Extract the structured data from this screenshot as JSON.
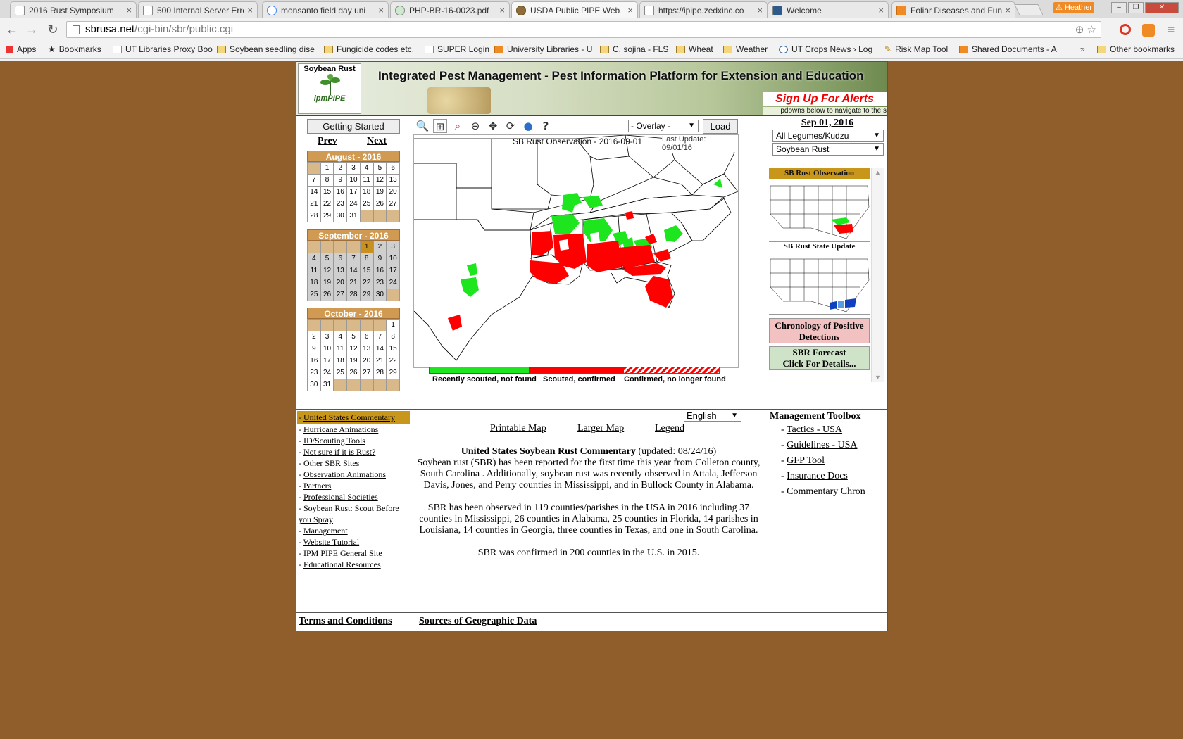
{
  "browser": {
    "tabs": [
      {
        "label": "2016 Rust Symposium"
      },
      {
        "label": "500 Internal Server Erro"
      },
      {
        "label": "monsanto field day uni"
      },
      {
        "label": "PHP-BR-16-0023.pdf"
      },
      {
        "label": "USDA Public PIPE Web"
      },
      {
        "label": "https://ipipe.zedxinc.co"
      },
      {
        "label": "Welcome"
      },
      {
        "label": "Foliar Diseases and Fun"
      }
    ],
    "user": "Heather",
    "url_domain": "sbrusa.net",
    "url_path": "/cgi-bin/sbr/public.cgi",
    "bookmarks": [
      "Apps",
      "Bookmarks",
      "UT Libraries Proxy Boo",
      "Soybean seedling dise",
      "Fungicide codes etc.",
      "SUPER Login",
      "University Libraries - U",
      "C. sojina - FLS",
      "Wheat",
      "Weather",
      "UT Crops News › Log",
      "Risk Map Tool",
      "Shared Documents - A",
      "»",
      "Other bookmarks"
    ]
  },
  "banner": {
    "logo_text": "Soybean Rust",
    "logo_sub": "ipmPIPE",
    "title": "Integrated Pest Management - Pest Information Platform for Extension and Education",
    "signup": "Sign Up For Alerts",
    "ticker": "pdowns below to navigate to the s"
  },
  "left": {
    "getting_started": "Getting Started",
    "prev": "Prev",
    "next": "Next",
    "months": [
      {
        "title": "August - 2016",
        "cells": [
          "",
          "1",
          "2",
          "3",
          "4",
          "5",
          "6",
          "7",
          "8",
          "9",
          "10",
          "11",
          "12",
          "13",
          "14",
          "15",
          "16",
          "17",
          "18",
          "19",
          "20",
          "21",
          "22",
          "23",
          "24",
          "25",
          "26",
          "27",
          "28",
          "29",
          "30",
          "31",
          "",
          "",
          ""
        ]
      },
      {
        "title": "September - 2016",
        "cells": [
          "",
          "",
          "",
          "",
          "1",
          "2",
          "3",
          "4",
          "5",
          "6",
          "7",
          "8",
          "9",
          "10",
          "11",
          "12",
          "13",
          "14",
          "15",
          "16",
          "17",
          "18",
          "19",
          "20",
          "21",
          "22",
          "23",
          "24",
          "25",
          "26",
          "27",
          "28",
          "29",
          "30",
          ""
        ]
      },
      {
        "title": "October - 2016",
        "cells": [
          "",
          "",
          "",
          "",
          "",
          "",
          "1",
          "2",
          "3",
          "4",
          "5",
          "6",
          "7",
          "8",
          "9",
          "10",
          "11",
          "12",
          "13",
          "14",
          "15",
          "16",
          "17",
          "18",
          "19",
          "20",
          "21",
          "22",
          "23",
          "24",
          "25",
          "26",
          "27",
          "28",
          "29",
          "30",
          "31",
          "",
          "",
          "",
          "",
          ""
        ]
      }
    ],
    "selected_day": "1"
  },
  "map": {
    "overlay": "- Overlay -",
    "load": "Load",
    "title": "SB Rust Observation - 2016-09-01",
    "last_update": "Last Update: 09/01/16",
    "legend": [
      "Recently scouted, not found",
      "Scouted, confirmed",
      "Confirmed, no longer found"
    ],
    "colors": {
      "not_found": "#1ee61e",
      "confirmed": "#ff0000"
    },
    "tools": [
      "zoom-in-icon",
      "zoom-box-icon",
      "zoom-state-icon",
      "zoom-out-icon",
      "pan-icon",
      "refresh-icon",
      "globe-icon",
      "help-icon"
    ]
  },
  "right": {
    "date": "Sep 01, 2016",
    "host": "All Legumes/Kudzu",
    "pest": "Soybean Rust",
    "obs_title": "SB Rust Observation",
    "state_title": "SB Rust State Update",
    "chronology": "Chronology of Positive Detections",
    "forecast_l1": "SBR Forecast",
    "forecast_l2": "Click For Details..."
  },
  "nav": {
    "items": [
      "United States Commentary",
      "Hurricane Animations",
      "ID/Scouting Tools",
      "Not sure if it is Rust?",
      "Other SBR Sites",
      "Observation Animations",
      "Partners",
      "Professional Societies",
      "Soybean Rust: Scout Before you Spray",
      "Management",
      "Website Tutorial",
      "IPM PIPE General Site",
      "Educational Resources"
    ]
  },
  "center": {
    "language": "English",
    "printable": "Printable Map",
    "larger": "Larger Map",
    "legend": "Legend",
    "commentary_title": "United States Soybean Rust Commentary",
    "commentary_updated": "(updated: 08/24/16)",
    "p1": "Soybean rust (SBR) has been reported for the first time this year from Colleton county, South Carolina . Additionally, soybean rust was recently observed in Attala, Jefferson Davis, Jones, and Perry counties in Mississippi, and in Bullock County in Alabama.",
    "p2": "SBR has been observed in 119 counties/parishes in the USA in 2016 including 37 counties in Mississippi, 26 counties in Alabama, 25 counties in Florida, 14 parishes in Louisiana, 14 counties in Georgia, three counties in Texas, and one in South Carolina.",
    "p3": "SBR was confirmed in 200 counties in the U.S. in 2015."
  },
  "toolbox": {
    "title": "Management Toolbox",
    "items": [
      "Tactics - USA",
      "Guidelines - USA",
      "GFP Tool",
      "Insurance Docs",
      "Commentary Chron"
    ]
  },
  "footer": {
    "terms": "Terms and Conditions",
    "sources": "Sources of Geographic Data"
  }
}
